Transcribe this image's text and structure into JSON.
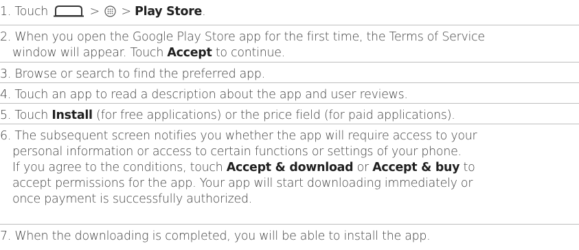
{
  "steps": [
    {
      "num": "1.",
      "parts": {
        "pre": "Touch",
        "sep1": ">",
        "sep2": ">",
        "bold": "Play Store",
        "end": "."
      },
      "icons": [
        "home-key-icon",
        "apps-grid-icon"
      ]
    },
    {
      "num": "2.",
      "lines": [
        "When you open the Google Play Store app for the first time, the Terms of Service",
        "window will appear. Touch"
      ],
      "bold": "Accept",
      "tail": "to continue."
    },
    {
      "num": "3.",
      "text": "Browse or search to find the preferred app."
    },
    {
      "num": "4.",
      "text": "Touch an app to read a description about the app and user reviews."
    },
    {
      "num": "5.",
      "pre": "Touch",
      "bold": "Install",
      "tail": "(for free applications) or the price field (for paid applications)."
    },
    {
      "num": "6.",
      "lines": [
        "The subsequent screen notifies you whether the app will require access to your",
        "personal information or access to certain functions or settings of your phone.",
        "If you agree to the conditions, touch",
        "accept permissions for the app. Your app will start downloading immediately or",
        "once payment is successfully authorized."
      ],
      "bold1": "Accept & download",
      "or": "or",
      "bold2": "Accept & buy",
      "to": "to"
    },
    {
      "num": "7.",
      "text": "When the downloading is completed, you will be able to install the app."
    }
  ]
}
